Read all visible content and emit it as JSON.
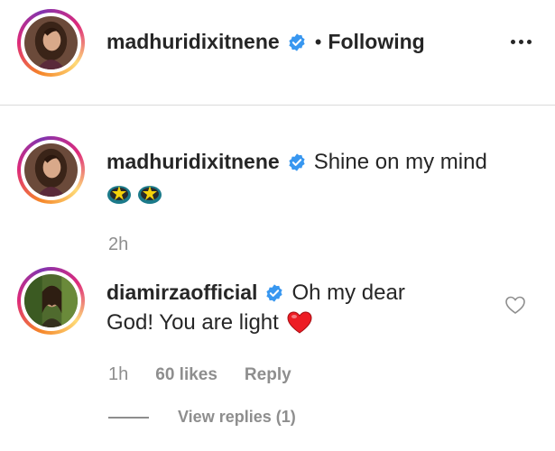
{
  "post": {
    "author": "madhuridixitnene",
    "separator": "•",
    "follow_status": "Following"
  },
  "caption": {
    "author": "madhuridixitnene",
    "text": "Shine on my mind",
    "emojis": [
      "star-struck-icon",
      "star-struck-icon"
    ],
    "time": "2h"
  },
  "comment": {
    "author": "diamirzaofficial",
    "text_line1": "Oh my dear",
    "text_line2": "God! You are light",
    "emoji": "red-heart-icon",
    "time": "1h",
    "likes": "60 likes",
    "reply_label": "Reply",
    "view_replies": "View replies (1)"
  },
  "colors": {
    "verified": "#3897f0",
    "secondary_text": "#8e8e8e",
    "heart": "#ed1c24"
  }
}
